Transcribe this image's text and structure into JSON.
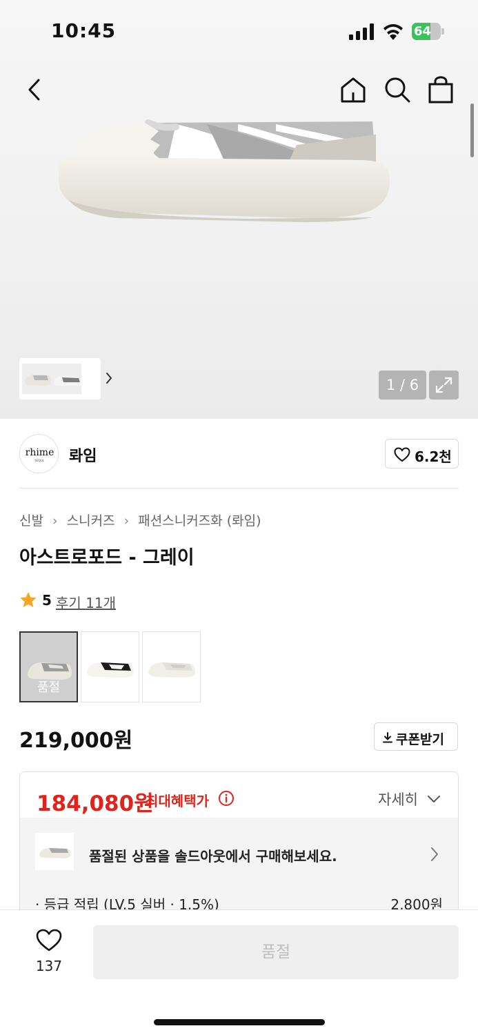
{
  "status_bar": {
    "time": "10:45",
    "battery": "64",
    "battery_level": 0.64
  },
  "gallery": {
    "counter": "1 / 6",
    "icons": [
      "back-icon",
      "home-icon",
      "search-icon",
      "shopping-bag-icon",
      "chevron-right-icon",
      "expand-icon"
    ]
  },
  "brand": {
    "logo_text": "rhime",
    "logo_sub": "SEOUL",
    "name": "롸임",
    "likes": "6.2천"
  },
  "product": {
    "breadcrumb": [
      "신발",
      "스니커즈",
      "패션스니커즈화 (롸임)"
    ],
    "title": "아스트로포드 - 그레이",
    "rating": "5",
    "reviews": "후기 11개",
    "options": [
      {
        "color": "grey",
        "soldout": true,
        "label": "품절"
      },
      {
        "color": "black",
        "soldout": false
      },
      {
        "color": "white",
        "soldout": false
      }
    ],
    "price": "219,000원",
    "coupon_label": "쿠폰받기"
  },
  "benefit": {
    "price": "184,080원",
    "label": "최대혜택가",
    "detail_label": "자세히",
    "soldout_banner": "품절된 상품을 솔드아웃에서 구매해보세요.",
    "point_label": "· 등급 적립 (LV.5 실버 · 1.5%)",
    "point_value": "2,800원"
  },
  "bottom": {
    "wish_count": "137",
    "buy_label": "품절"
  },
  "colors": {
    "accent_red": "#e2231a",
    "rating_star": "#f5a623",
    "battery_green": "#39c45b"
  }
}
